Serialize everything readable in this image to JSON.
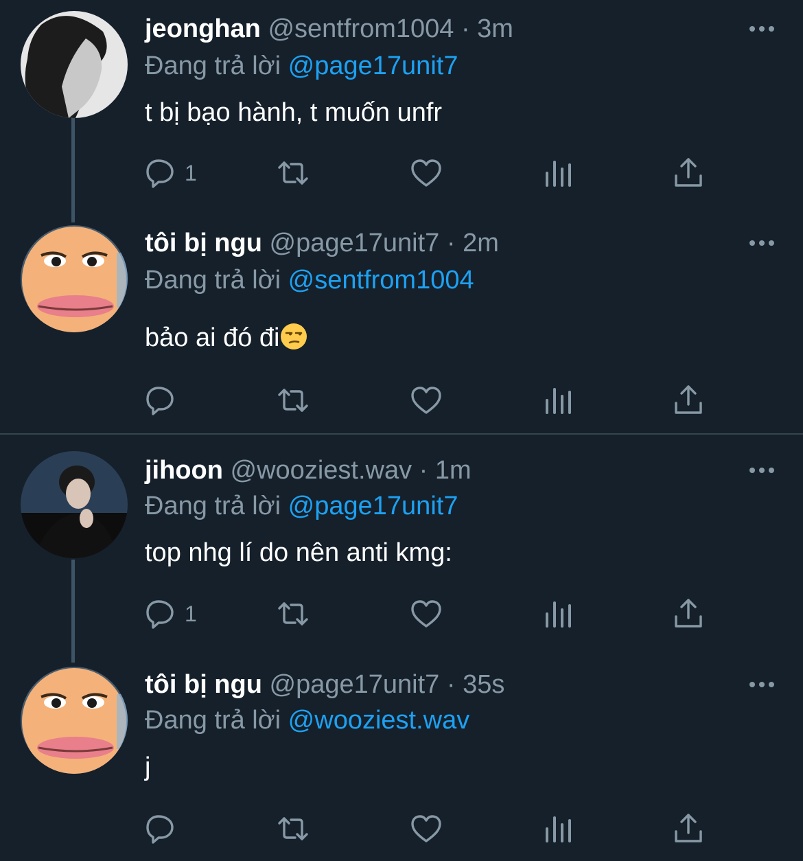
{
  "colors": {
    "background": "#15202b",
    "secondary_text": "#8899a6",
    "link": "#1da1f2",
    "divider": "#38444d"
  },
  "tweets": [
    {
      "name": "jeonghan",
      "handle": "@sentfrom1004",
      "dot": "·",
      "time": "3m",
      "replying_label": "Đang trả lời",
      "replying_to": "@page17unit7",
      "text": "t bị bạo hành, t muốn unfr",
      "reply_count": "1",
      "avatar": "bw-portrait-avatar"
    },
    {
      "name": "tôi bị ngu",
      "handle": "@page17unit7",
      "dot": "·",
      "time": "2m",
      "replying_label": "Đang trả lời",
      "replying_to": "@sentfrom1004",
      "text": "bảo ai đó đi",
      "emoji": "unamused-face-emoji",
      "reply_count": "",
      "avatar": "cartoon-face-avatar"
    },
    {
      "name": "jihoon",
      "handle": "@wooziest.wav",
      "dot": "·",
      "time": "1m",
      "replying_label": "Đang trả lời",
      "replying_to": "@page17unit7",
      "text": "top nhg lí do nên anti kmg:",
      "reply_count": "1",
      "avatar": "dark-portrait-avatar"
    },
    {
      "name": "tôi bị ngu",
      "handle": "@page17unit7",
      "dot": "·",
      "time": "35s",
      "replying_label": "Đang trả lời",
      "replying_to": "@wooziest.wav",
      "text": "j",
      "reply_count": "",
      "avatar": "cartoon-face-avatar"
    }
  ],
  "action_icons": [
    "reply-icon",
    "retweet-icon",
    "like-icon",
    "analytics-icon",
    "share-icon"
  ]
}
